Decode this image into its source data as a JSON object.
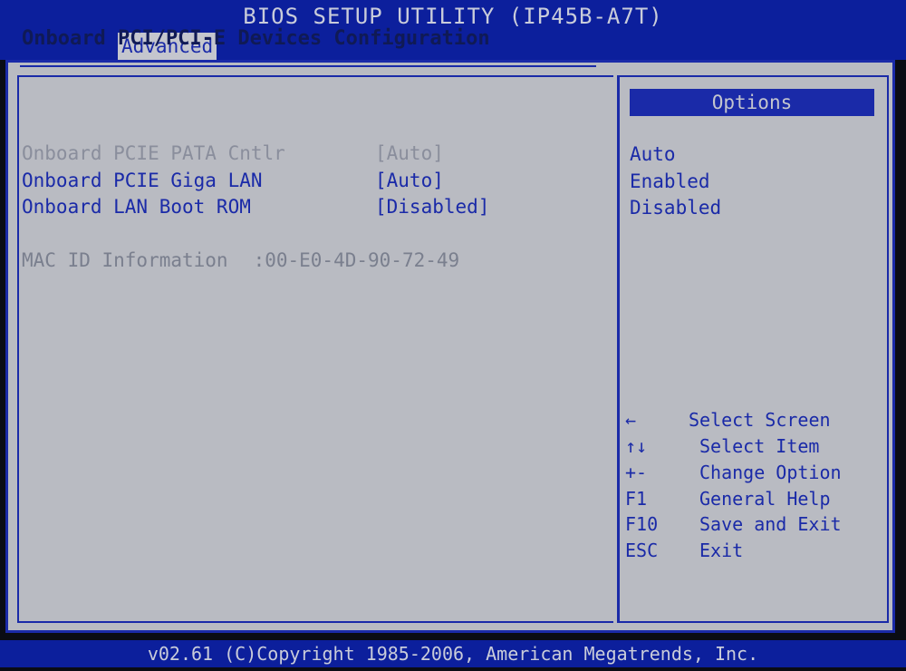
{
  "window": {
    "title": "BIOS SETUP UTILITY (IP45B-A7T)"
  },
  "menu": {
    "active_tab": "Advanced"
  },
  "page": {
    "title": "Onboard PCI/PCI-E Devices Configuration"
  },
  "settings": [
    {
      "label": "Onboard PCIE PATA Cntlr",
      "value": "[Auto]",
      "state": "disabled"
    },
    {
      "label": "Onboard PCIE Giga LAN",
      "value": "[Auto]",
      "state": "active"
    },
    {
      "label": "Onboard LAN Boot ROM",
      "value": "[Disabled]",
      "state": "active"
    }
  ],
  "mac_info": {
    "label": "MAC ID Information",
    "value": ":00-E0-4D-90-72-49"
  },
  "options_panel": {
    "header": "Options",
    "items": [
      "Auto",
      "Enabled",
      "Disabled"
    ]
  },
  "key_help": [
    {
      "key": "←",
      "desc": "Select Screen"
    },
    {
      "key": "↑↓",
      "desc": "Select Item"
    },
    {
      "key": "+-",
      "desc": "Change Option"
    },
    {
      "key": "F1",
      "desc": "General Help"
    },
    {
      "key": "F10",
      "desc": "Save and Exit"
    },
    {
      "key": "ESC",
      "desc": "Exit"
    }
  ],
  "footer": {
    "text": "v02.61 (C)Copyright 1985-2006, American Megatrends, Inc."
  },
  "colors": {
    "bar_blue": "#0c1f9c",
    "panel_gray": "#b9bbc2",
    "text_blue": "#1a2aa8",
    "text_disabled": "#8a8e9c"
  }
}
